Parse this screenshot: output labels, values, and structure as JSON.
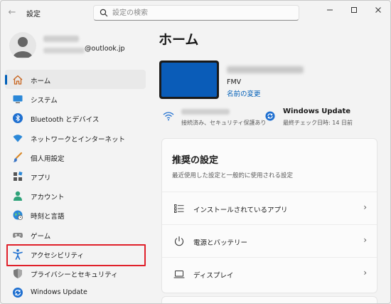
{
  "titlebar": {
    "app_title": "設定",
    "back_icon": "back-arrow-icon",
    "search_placeholder": "設定の検索"
  },
  "profile": {
    "email_suffix": "@outlook.jp"
  },
  "sidebar": {
    "items": [
      {
        "label": "ホーム",
        "icon": "home-icon"
      },
      {
        "label": "システム",
        "icon": "monitor-icon"
      },
      {
        "label": "Bluetooth とデバイス",
        "icon": "bluetooth-icon"
      },
      {
        "label": "ネットワークとインターネット",
        "icon": "wifi-icon"
      },
      {
        "label": "個人用設定",
        "icon": "brush-icon"
      },
      {
        "label": "アプリ",
        "icon": "apps-icon"
      },
      {
        "label": "アカウント",
        "icon": "person-icon"
      },
      {
        "label": "時刻と言語",
        "icon": "globe-clock-icon"
      },
      {
        "label": "ゲーム",
        "icon": "gamepad-icon"
      },
      {
        "label": "アクセシビリティ",
        "icon": "accessibility-icon"
      },
      {
        "label": "プライバシーとセキュリティ",
        "icon": "shield-icon"
      },
      {
        "label": "Windows Update",
        "icon": "sync-icon"
      }
    ]
  },
  "main": {
    "page_title": "ホーム",
    "device_model": "FMV",
    "rename_link": "名前の変更",
    "wifi_status": "接続済み、セキュリティ保護あり",
    "wu_title": "Windows Update",
    "wu_sub": "最終チェック日時: 14 日前",
    "card": {
      "title": "推奨の設定",
      "subtitle": "最近使用した設定と一般的に使用される設定",
      "items": [
        {
          "label": "インストールされているアプリ",
          "icon": "list-icon"
        },
        {
          "label": "電源とバッテリー",
          "icon": "power-icon"
        },
        {
          "label": "ディスプレイ",
          "icon": "laptop-icon"
        }
      ]
    }
  },
  "colors": {
    "accent": "#005fb8",
    "highlight_border": "#e0202a"
  }
}
